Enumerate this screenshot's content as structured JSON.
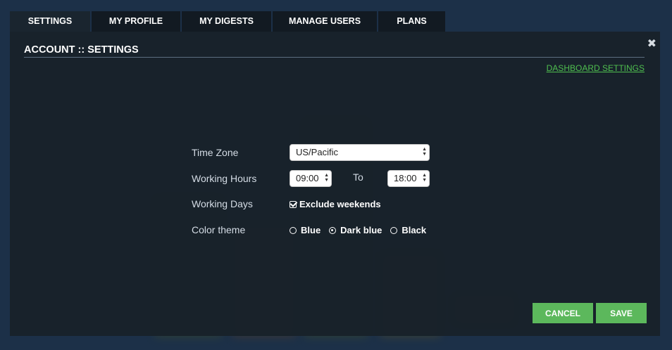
{
  "tabs": [
    {
      "label": "SETTINGS",
      "active": true
    },
    {
      "label": "MY PROFILE",
      "active": false
    },
    {
      "label": "MY DIGESTS",
      "active": false
    },
    {
      "label": "MANAGE USERS",
      "active": false
    },
    {
      "label": "PLANS",
      "active": false
    }
  ],
  "dialog": {
    "title": "ACCOUNT :: SETTINGS",
    "close_icon": "close-icon",
    "dashboard_link": "DASHBOARD SETTINGS"
  },
  "form": {
    "time_zone": {
      "label": "Time Zone",
      "value": "US/Pacific"
    },
    "working_hours": {
      "label": "Working Hours",
      "from": "09:00",
      "to_label": "To",
      "to": "18:00"
    },
    "working_days": {
      "label": "Working Days",
      "checkbox_label": "Exclude weekends",
      "checked": true
    },
    "color_theme": {
      "label": "Color theme",
      "options": [
        {
          "label": "Blue",
          "selected": false
        },
        {
          "label": "Dark blue",
          "selected": true
        },
        {
          "label": "Black",
          "selected": false
        }
      ]
    }
  },
  "buttons": {
    "cancel": "CANCEL",
    "save": "SAVE"
  },
  "colors": {
    "accent_green": "#5cb85c",
    "link_green": "#4fbf4f",
    "dialog_bg": "#18212a",
    "tab_bg": "#121a22"
  }
}
